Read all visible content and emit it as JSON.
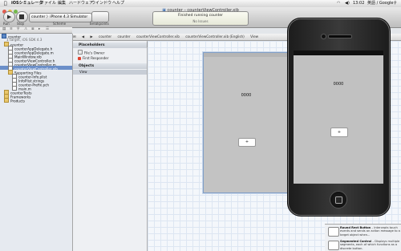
{
  "menubar": {
    "app": "iOSシミュレータ",
    "menus": [
      "ファイル",
      "編集",
      "ハードウェア",
      "ウインドウ",
      "ヘルプ"
    ],
    "clock": "13:02",
    "search_source": "英語 / Google"
  },
  "xcode": {
    "document_title": "counter – counterViewController.xib",
    "toolbar": {
      "run_label": "Run",
      "stop_label": "Stop",
      "scheme_label": "Scheme",
      "scheme_value": "counter 〉iPhone 4.3 Simulator",
      "breakpoints_label": "Breakpoints"
    },
    "activity": {
      "status": "Finished running counter",
      "issues": "No Issues"
    },
    "navigator": {
      "items": [
        {
          "label": "counter",
          "icon": "project-icon",
          "indent": 0,
          "selected": false
        },
        {
          "label": "1 target, iOS SDK 4.3",
          "icon": "none",
          "indent": 1,
          "selected": false
        },
        {
          "label": "counter",
          "icon": "folder-icon",
          "indent": 1,
          "selected": false
        },
        {
          "label": "counterAppDelegate.h",
          "icon": "file-icon",
          "indent": 2,
          "selected": false
        },
        {
          "label": "counterAppDelegate.m",
          "icon": "file-icon",
          "indent": 2,
          "selected": false
        },
        {
          "label": "MainWindow.xib",
          "icon": "file-icon",
          "indent": 2,
          "selected": false
        },
        {
          "label": "counterViewController.h",
          "icon": "file-icon",
          "indent": 2,
          "selected": false
        },
        {
          "label": "counterViewController.m",
          "icon": "file-icon",
          "indent": 2,
          "selected": false
        },
        {
          "label": "counterViewController.xib",
          "icon": "file-icon",
          "indent": 2,
          "selected": true
        },
        {
          "label": "Supporting Files",
          "icon": "folder-icon",
          "indent": 2,
          "selected": false
        },
        {
          "label": "counter-Info.plist",
          "icon": "file-icon",
          "indent": 3,
          "selected": false
        },
        {
          "label": "InfoPlist.strings",
          "icon": "file-icon",
          "indent": 3,
          "selected": false
        },
        {
          "label": "counter-Prefix.pch",
          "icon": "file-icon",
          "indent": 3,
          "selected": false
        },
        {
          "label": "main.m",
          "icon": "file-icon",
          "indent": 3,
          "selected": false
        },
        {
          "label": "counterTests",
          "icon": "folder-icon",
          "indent": 1,
          "selected": false
        },
        {
          "label": "Frameworks",
          "icon": "folder-icon",
          "indent": 1,
          "selected": false
        },
        {
          "label": "Products",
          "icon": "folder-icon",
          "indent": 1,
          "selected": false
        }
      ]
    },
    "jumpbar": [
      "counter",
      "counter",
      "counterViewController.xib",
      "counterViewController.xib (English)",
      "View"
    ],
    "outline": {
      "placeholders_title": "Placeholders",
      "files_owner": "File's Owner",
      "first_responder": "First Responder",
      "objects_title": "Objects",
      "view_row": "View"
    },
    "canvas": {
      "count_label": "0000",
      "plus_button": "+"
    },
    "library": [
      {
        "title": "Round Rect Button",
        "desc": "– Intercepts touch events and sends an action message to a target object when..."
      },
      {
        "title": "Segmented Control",
        "desc": "– Displays multiple segments, each of which functions as a discrete button."
      }
    ]
  },
  "simulator": {
    "count_label": "0000",
    "plus_button": "+"
  }
}
